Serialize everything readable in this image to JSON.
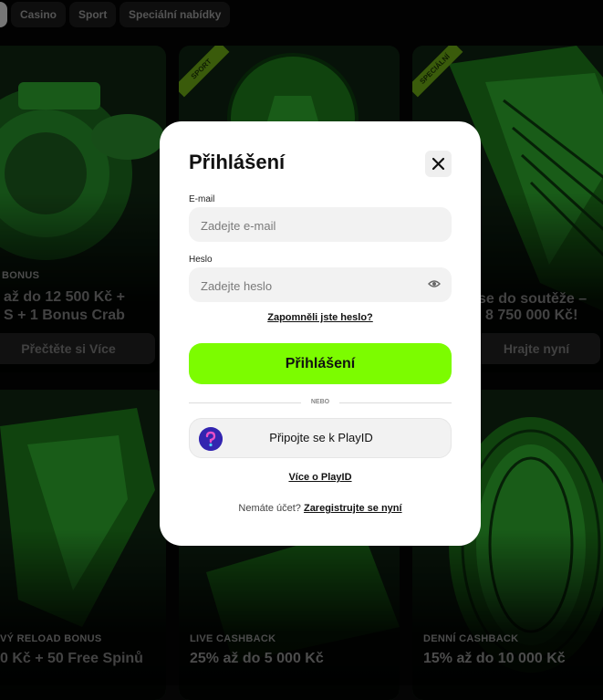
{
  "nav": {
    "tabs": [
      "Casino",
      "Sport",
      "Speciální nabídky"
    ]
  },
  "cards": [
    {
      "ribbon": "",
      "tag": "BONUS",
      "headline_lines": [
        "až do 12 500 Kč +",
        "S + 1 Bonus Crab"
      ],
      "cta": "Přečtěte si Více"
    },
    {
      "ribbon": "SPORT",
      "tag": "",
      "headline_lines": [
        "",
        ""
      ],
      "cta": ""
    },
    {
      "ribbon": "SPECIÁLNÍ",
      "tag": "",
      "headline_lines": [
        "se do soutěže –",
        "8 750 000 Kč!"
      ],
      "cta": "Hrajte nyní"
    },
    {
      "ribbon": "",
      "tag": "VÝ RELOAD BONUS",
      "headline_lines": [
        "0 Kč + 50 Free Spinů"
      ],
      "cta": ""
    },
    {
      "ribbon": "",
      "tag": "LIVE CASHBACK",
      "headline_lines": [
        "25% až do 5 000 Kč"
      ],
      "cta": ""
    },
    {
      "ribbon": "",
      "tag": "DENNÍ CASHBACK",
      "headline_lines": [
        "15% až do 10 000 Kč"
      ],
      "cta": ""
    }
  ],
  "modal": {
    "title": "Přihlášení",
    "email_label": "E-mail",
    "email_placeholder": "Zadejte e-mail",
    "email_value": "",
    "password_label": "Heslo",
    "password_placeholder": "Zadejte heslo",
    "password_value": "",
    "forgot_link": "Zapomněli jste heslo?",
    "login_button": "Přihlášení",
    "divider_text": "NEBO",
    "playid_button": "Připojte se k PlayID",
    "more_playid_link": "Více o PlayID",
    "no_account_text": "Nemáte účet?",
    "register_link": "Zaregistrujte se nyní"
  },
  "colors": {
    "accent": "#7cfc00",
    "background": "#050505",
    "modal": "#ffffff",
    "card_green": "#1e7a1a"
  },
  "icons": {
    "close": "close-icon",
    "eye": "eye-icon",
    "playid": "playid-logo-icon"
  }
}
